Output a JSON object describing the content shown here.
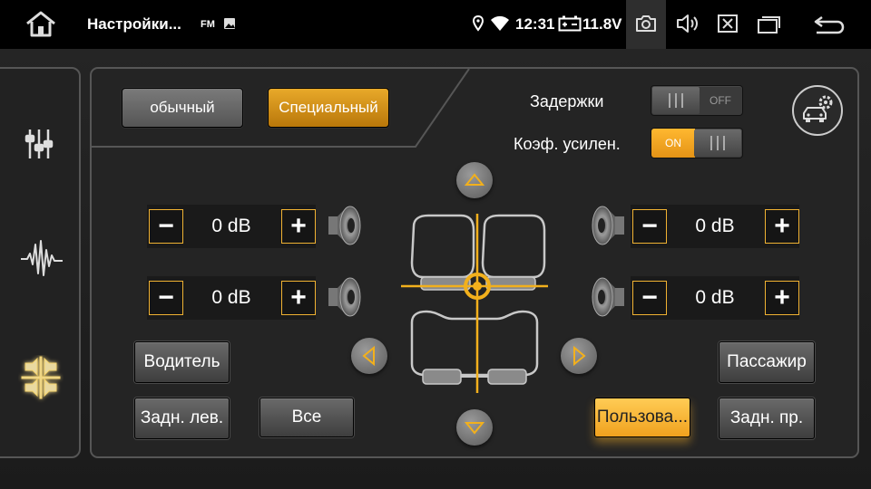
{
  "status_bar": {
    "title": "Настройки...",
    "fm": "FM",
    "time": "12:31",
    "voltage": "11.8V"
  },
  "modes": {
    "normal": "обычный",
    "special": "Специальный"
  },
  "toggles": {
    "delay_label": "Задержки",
    "delay_state": "OFF",
    "gain_label": "Коэф. усилен.",
    "gain_state": "ON"
  },
  "gains": {
    "front_left": "0 dB",
    "rear_left": "0 dB",
    "front_right": "0 dB",
    "rear_right": "0 dB"
  },
  "seats": {
    "driver": "Водитель",
    "passenger": "Пассажир",
    "rear_left": "Задн. лев.",
    "all": "Все",
    "user": "Пользова...",
    "rear_right": "Задн. пр."
  },
  "colors": {
    "accent": "#f0a11e",
    "crosshair": "#f2b01c",
    "panel_border": "#565656"
  },
  "icons": {
    "home": "home-icon",
    "location": "location-icon",
    "wifi": "wifi-icon",
    "battery": "battery-icon",
    "camera": "camera-icon",
    "volume": "volume-icon",
    "close": "close-box-icon",
    "recents": "recent-apps-icon",
    "back": "back-icon"
  }
}
